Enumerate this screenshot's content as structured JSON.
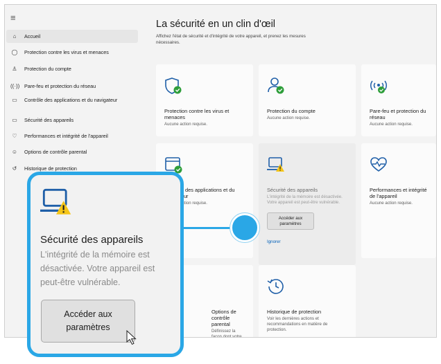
{
  "window": {
    "menu_icon": "hamburger-icon"
  },
  "sidebar": {
    "items": [
      {
        "icon": "home-icon",
        "label": "Accueil"
      },
      {
        "icon": "shield-icon",
        "label": "Protection contre les virus et menaces"
      },
      {
        "icon": "person-icon",
        "label": "Protection du compte"
      },
      {
        "icon": "wifi-antenna-icon",
        "label": "Pare-feu et protection du réseau"
      },
      {
        "icon": "app-window-icon",
        "label": "Contrôle des applications et du navigateur"
      },
      {
        "icon": "laptop-icon",
        "label": "Sécurité des appareils"
      },
      {
        "icon": "heart-pulse-icon",
        "label": "Performances et intégrité de l'appareil"
      },
      {
        "icon": "family-icon",
        "label": "Options de contrôle parental"
      },
      {
        "icon": "history-icon",
        "label": "Historique de protection"
      }
    ]
  },
  "main": {
    "title": "La sécurité en un clin d'œil",
    "subtitle": "Affichez l'état de sécurité et d'intégrité de votre appareil, et prenez les mesures nécessaires.",
    "cards": [
      {
        "icon": "shield-check-icon",
        "title": "Protection contre les virus et menaces",
        "status": "Aucune action requise."
      },
      {
        "icon": "person-check-icon",
        "title": "Protection du compte",
        "status": "Aucune action requise."
      },
      {
        "icon": "antenna-check-icon",
        "title": "Pare-feu et protection du réseau",
        "status": "Aucune action requise."
      },
      {
        "icon": "browser-check-icon",
        "title": "Contrôle des applications et du navigateur",
        "status": "Aucune action requise."
      },
      {
        "icon": "laptop-warning-icon",
        "title": "Sécurité des appareils",
        "status": "L'intégrité de la mémoire est désactivée. Votre appareil est peut-être vulnérable.",
        "button": "Accéder aux paramètres",
        "link": "Ignorer"
      },
      {
        "icon": "heart-pulse-icon",
        "title": "Performances et intégrité de l'appareil",
        "status": "Aucune action requise."
      },
      {
        "icon": "family-icon",
        "title": "Options de contrôle parental",
        "status": "Définissez la façon dont votre famille utilise ses appareils."
      },
      {
        "icon": "history-icon",
        "title": "Historique de protection",
        "status": "Voir les dernières actions et recommandations en matière de protection."
      }
    ]
  },
  "zoom": {
    "icon": "laptop-warning-icon",
    "title": "Sécurité des appareils",
    "description": "L'intégrité de la mémoire est désactivée. Votre appareil est peut-être vulnérable.",
    "button": "Accéder aux paramètres"
  },
  "colors": {
    "accent": "#2aa7e6",
    "ok_green": "#2e9e3a",
    "warning": "#f5c518",
    "icon_blue": "#1f5fa8",
    "link": "#005fb8"
  }
}
